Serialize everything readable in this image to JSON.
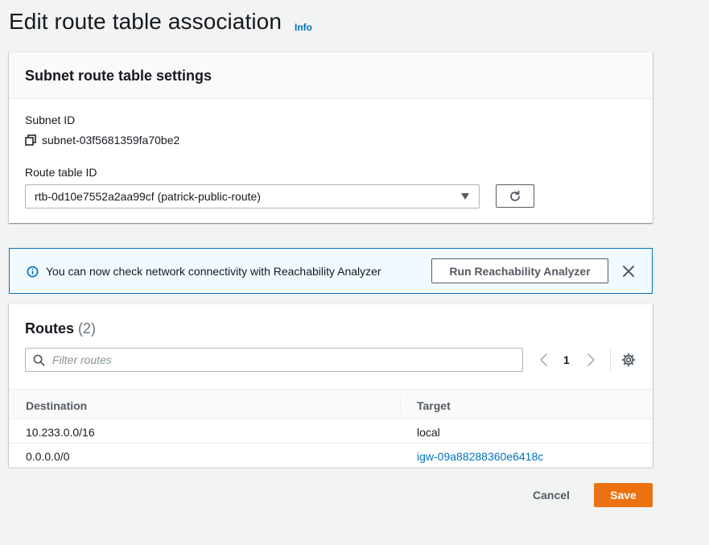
{
  "page": {
    "title": "Edit route table association",
    "info_link": "Info"
  },
  "settings_panel": {
    "heading": "Subnet route table settings",
    "subnet_id_label": "Subnet ID",
    "subnet_id_value": "subnet-03f5681359fa70be2",
    "route_table_label": "Route table ID",
    "route_table_selected": "rtb-0d10e7552a2aa99cf (patrick-public-route)",
    "icons": {
      "copy": "copy-icon",
      "caret": "caret-down-icon",
      "refresh": "refresh-icon"
    }
  },
  "banner": {
    "message": "You can now check network connectivity with Reachability Analyzer",
    "button_label": "Run Reachability Analyzer",
    "icons": {
      "info": "info-icon",
      "close": "close-icon"
    },
    "colors": {
      "border": "#0073bb",
      "background": "#f1faff"
    }
  },
  "routes": {
    "heading": "Routes",
    "count": "(2)",
    "filter_placeholder": "Filter routes",
    "page_number": "1",
    "columns": [
      "Destination",
      "Target"
    ],
    "rows": [
      {
        "destination": "10.233.0.0/16",
        "target": "local"
      },
      {
        "destination": "0.0.0.0/0",
        "target": "igw-09a88288360e6418c"
      }
    ],
    "icons": {
      "search": "search-icon",
      "prev": "chevron-left-icon",
      "next": "chevron-right-icon",
      "preferences": "gear-icon"
    }
  },
  "footer": {
    "cancel_label": "Cancel",
    "save_label": "Save",
    "colors": {
      "primary": "#ec7211"
    }
  }
}
